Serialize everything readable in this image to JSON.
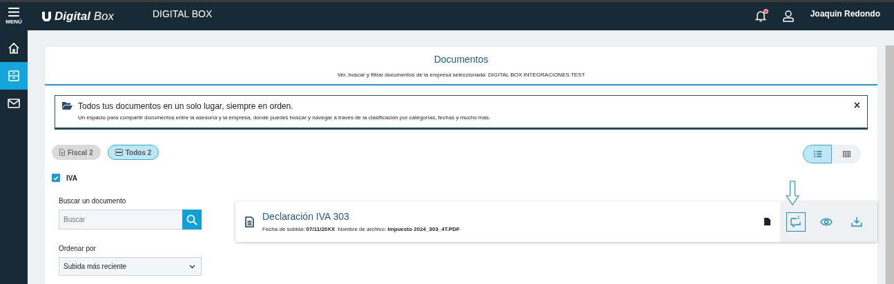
{
  "topbar": {
    "menu_label": "MENÚ",
    "logo_text": "Digital",
    "logo_sub": "Box",
    "app_title": "DIGITAL BOX",
    "notifications_unread": true,
    "user_name": "Joaquin Redondo"
  },
  "sidebar": {
    "items": [
      {
        "kind": "home",
        "selected": false
      },
      {
        "kind": "documents",
        "selected": true
      },
      {
        "kind": "mail",
        "selected": false
      }
    ]
  },
  "header": {
    "title": "Documentos",
    "subtitle": "Ver, buscar y filtrar documentos de la empresa seleccionada: DIGITAL BOX INTEGRACIONES TEST"
  },
  "banner": {
    "title": "Todos tus documentos en un solo lugar, siempre en orden.",
    "text": "Un espacio para compartir documentos entre la asesoría y la empresa, donde puedes buscar y navegar a través de la clasificación por categorías, fechas y mucho más.",
    "close": "×"
  },
  "chips": [
    {
      "label": "Fiscal 2",
      "kind": "fiscal",
      "selected": false
    },
    {
      "label": "Todos 2",
      "kind": "all",
      "selected": true
    }
  ],
  "view_toggle": [
    {
      "kind": "list",
      "selected": true
    },
    {
      "kind": "grid",
      "selected": false
    }
  ],
  "filters": [
    {
      "label": "IVA",
      "checked": true
    }
  ],
  "search": {
    "label": "Buscar un documento",
    "placeholder": "Buscar"
  },
  "sort": {
    "label": "Ordenar por",
    "value": "Subida más reciente"
  },
  "documents": [
    {
      "title": "Declaración IVA 303",
      "date_label": "Fecha de subida:",
      "date": "07/11/20XX",
      "file_label": "Nombre de archivo:",
      "file": "Impuesto 2024_303_4T.PDF",
      "comments": "1",
      "highlighted": true
    }
  ]
}
